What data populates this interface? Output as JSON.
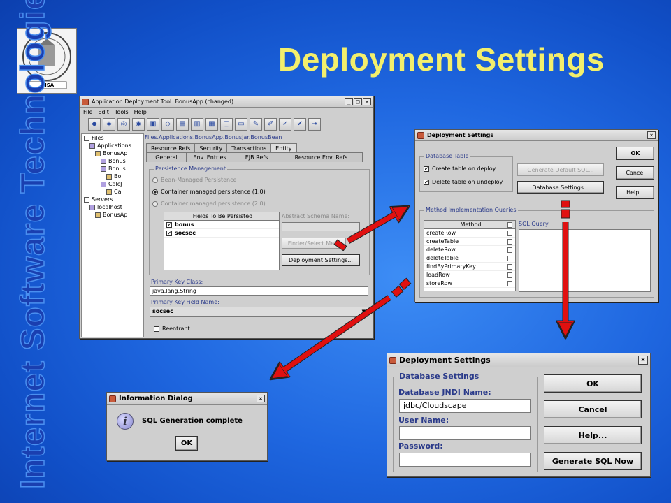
{
  "slide": {
    "title": "Deployment Settings",
    "vertical_title": "Internet Software Technologies",
    "seal_text": "PISA"
  },
  "main_window": {
    "title": "Application Deployment Tool: BonusApp (changed)",
    "controls": [
      "_",
      "□",
      "×"
    ],
    "menu": [
      "File",
      "Edit",
      "Tools",
      "Help"
    ],
    "toolbar_icons": [
      "app-icon",
      "ejb-icon",
      "jar-icon",
      "web-icon",
      "client-icon",
      "add-icon",
      "db-icon",
      "deploy-icon",
      "server-icon",
      "open-icon",
      "save-icon",
      "edit-icon",
      "inspect-icon",
      "verify-icon",
      "check-icon",
      "exit-icon"
    ],
    "path": "Files.Applications.BonusApp.BonusJar.BonusBean",
    "tree": [
      {
        "label": "Files",
        "indent": 0
      },
      {
        "label": "Applications",
        "indent": 1
      },
      {
        "label": "BonusAp",
        "indent": 2
      },
      {
        "label": "Bonus",
        "indent": 3
      },
      {
        "label": "Bonus",
        "indent": 3
      },
      {
        "label": "Bo",
        "indent": 4
      },
      {
        "label": "CalcJ",
        "indent": 3
      },
      {
        "label": "Ca",
        "indent": 4
      },
      {
        "label": "Servers",
        "indent": 0
      },
      {
        "label": "localhost",
        "indent": 1
      },
      {
        "label": "BonusAp",
        "indent": 2
      }
    ],
    "tabs_row1": [
      "Resource Refs",
      "Security",
      "Transactions",
      "Entity"
    ],
    "tabs_row2": [
      "General",
      "Env. Entries",
      "EJB Refs",
      "Resource Env. Refs"
    ],
    "persistence_label": "Persistence Management",
    "radio_bean": "Bean-Managed Persistence",
    "radio_container_1": "Container managed persistence (1.0)",
    "radio_container_2": "Container managed persistence (2.0)",
    "fields_header": "Fields To Be Persisted",
    "fields": [
      "bonus",
      "socsec"
    ],
    "abstract_schema_label": "Abstract Schema Name:",
    "finder_button": "Finder/Select Meth",
    "deployment_settings_button": "Deployment Settings...",
    "primary_key_class_label": "Primary Key Class:",
    "primary_key_class_value": "java.lang.String",
    "primary_key_field_label": "Primary Key Field Name:",
    "primary_key_field_value": "socsec",
    "reentrant_label": "Reentrant"
  },
  "deploy_dialog": {
    "title": "Deployment Settings",
    "database_table_label": "Database Table",
    "create_table": "Create table on deploy",
    "delete_table": "Delete table on undeploy",
    "generate_sql_button": "Generate Default SQL...",
    "database_settings_button": "Database Settings...",
    "ok_button": "OK",
    "cancel_button": "Cancel",
    "help_button": "Help...",
    "queries_label": "Method Implementation Queries",
    "method_header": "Method",
    "methods": [
      "createRow",
      "createTable",
      "deleteRow",
      "deleteTable",
      "findByPrimaryKey",
      "loadRow",
      "storeRow"
    ],
    "sql_query_label": "SQL Query:"
  },
  "db_dialog": {
    "title": "Deployment Settings",
    "database_settings_label": "Database Settings",
    "jndi_label": "Database JNDI Name:",
    "jndi_value": "jdbc/Cloudscape",
    "user_label": "User Name:",
    "user_value": "",
    "password_label": "Password:",
    "password_value": "",
    "ok_button": "OK",
    "cancel_button": "Cancel",
    "help_button": "Help...",
    "generate_button": "Generate SQL Now"
  },
  "info_dialog": {
    "title": "Information Dialog",
    "message": "SQL Generation complete",
    "ok_button": "OK"
  },
  "colors": {
    "title_yellow": "#f3ef6c",
    "arrow_red": "#e01010",
    "window_gray": "#cfcfcf"
  }
}
